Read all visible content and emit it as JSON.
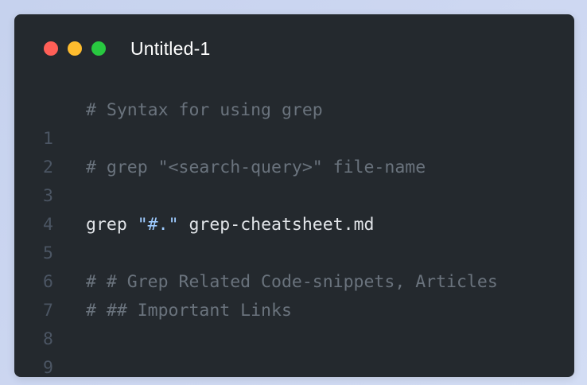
{
  "window": {
    "title": "Untitled-1",
    "controls": [
      "close",
      "minimize",
      "maximize"
    ]
  },
  "colors": {
    "background_gradient": [
      "#c6d2ee",
      "#d3ddf4"
    ],
    "editor_bg": "#24292e",
    "comment": "#6a737d",
    "plain": "#e1e4e8",
    "string": "#9ecbff",
    "line_number": "#4b5563",
    "close": "#ff5f57",
    "minimize": "#febc2e",
    "maximize": "#28c840"
  },
  "editor": {
    "lines": [
      {
        "number": "1",
        "text": "# Syntax for using grep"
      },
      {
        "number": "2",
        "text": ""
      },
      {
        "number": "3",
        "text": "# grep \"<search-query>\" file-name"
      },
      {
        "number": "4",
        "text": ""
      },
      {
        "number": "5",
        "command": "grep",
        "string": "\"#.\"",
        "arg": "grep-cheatsheet.md"
      },
      {
        "number": "6",
        "text": ""
      },
      {
        "number": "7",
        "text": "# # Grep Related Code-snippets, Articles"
      },
      {
        "number": "8",
        "text": "# ## Important Links"
      },
      {
        "number": "9",
        "text": ""
      }
    ]
  }
}
